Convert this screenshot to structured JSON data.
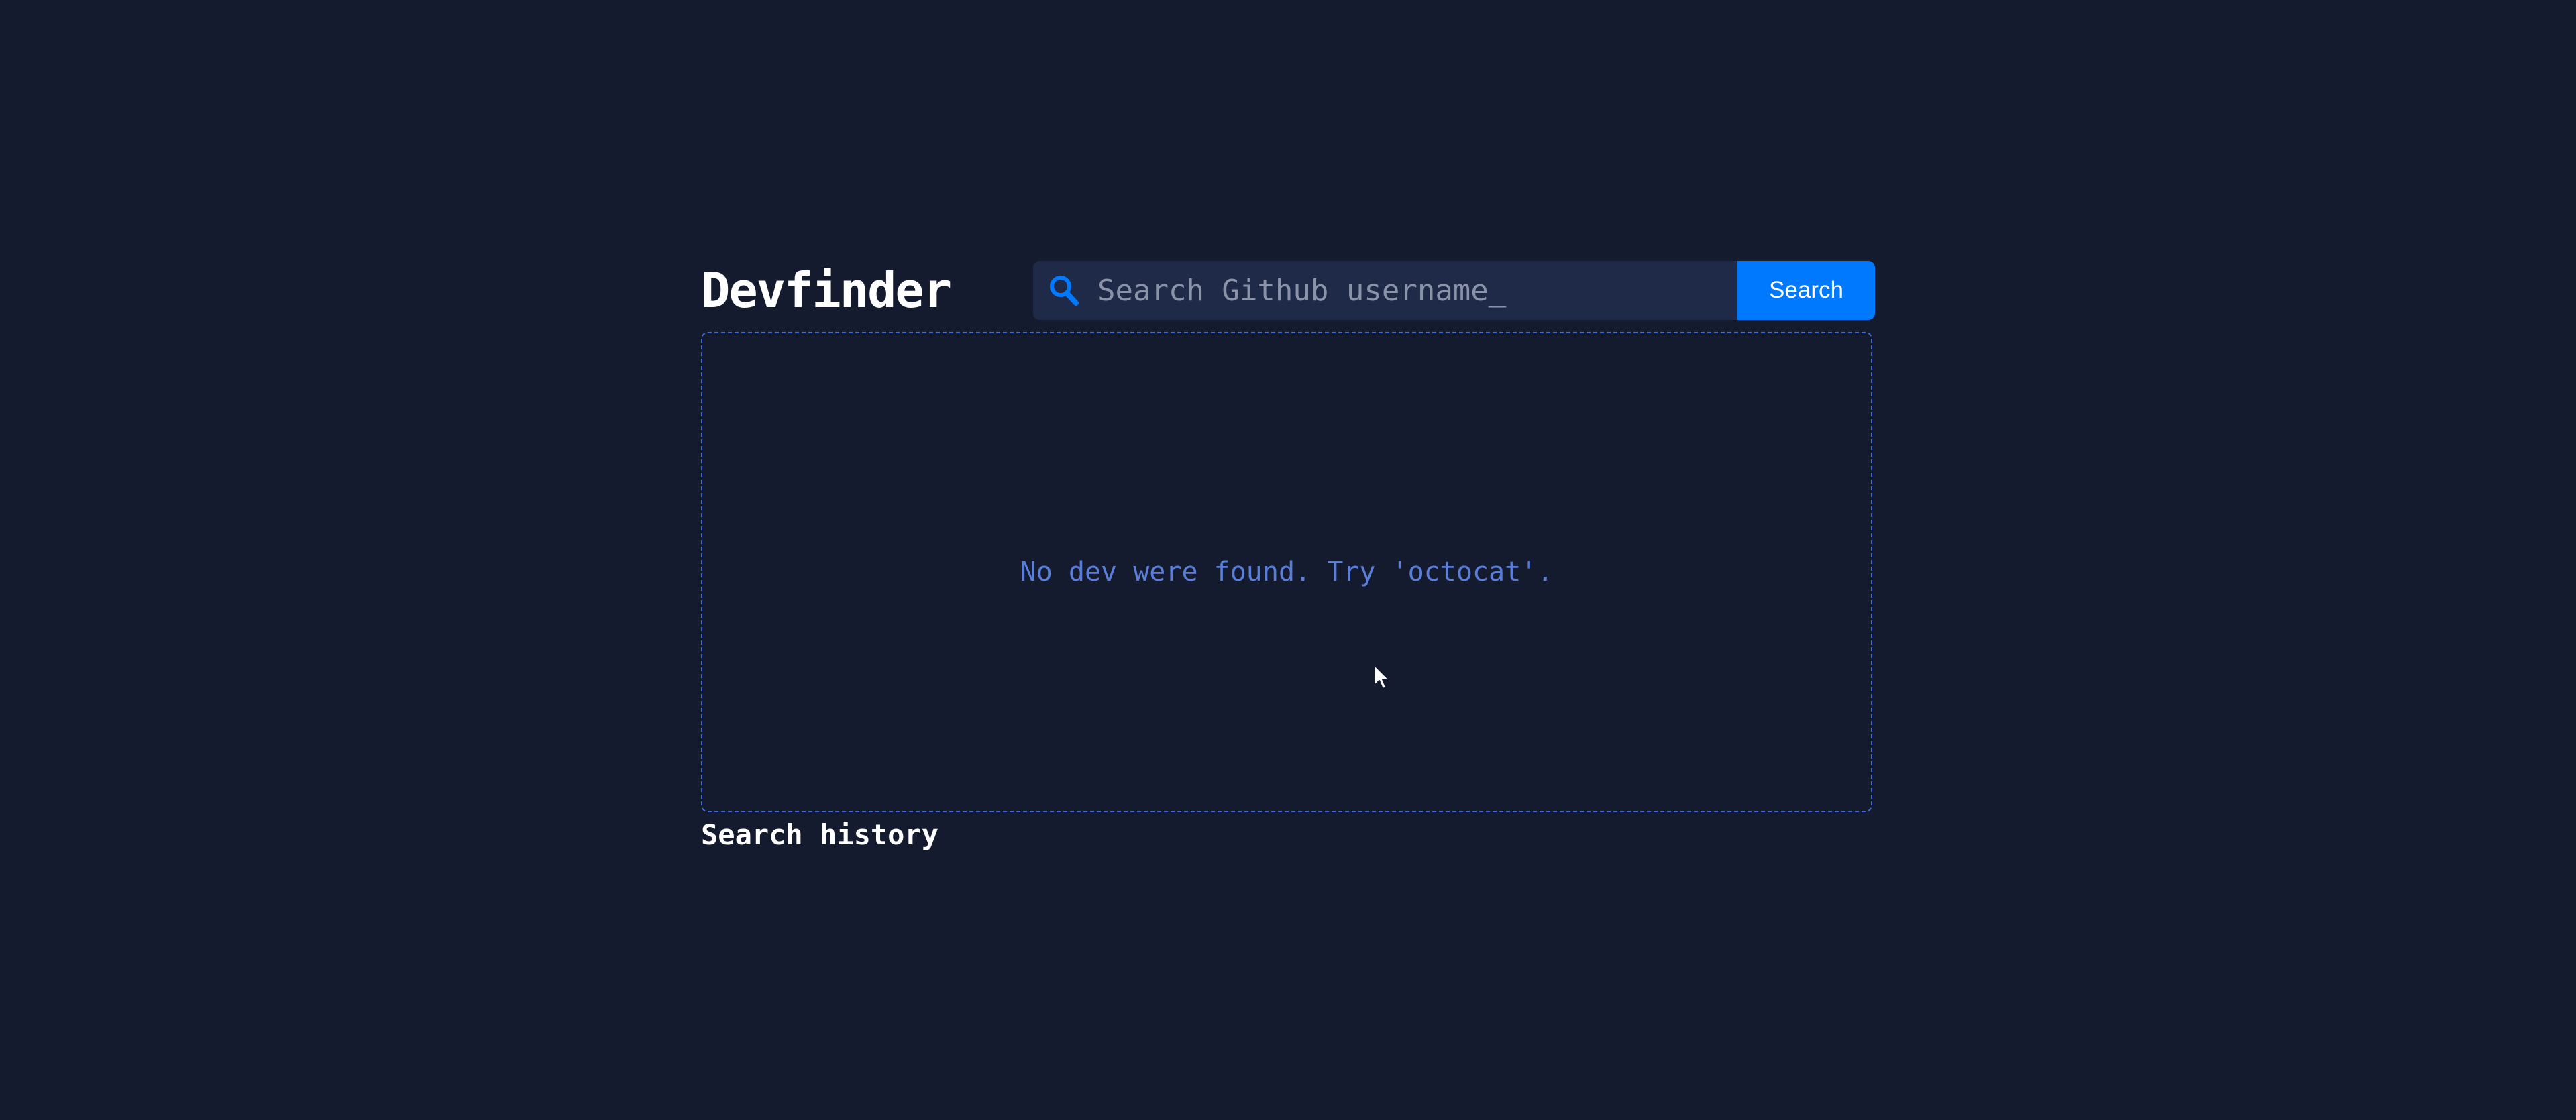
{
  "app": {
    "title": "Devfinder"
  },
  "search": {
    "placeholder": "Search Github username_",
    "value": "",
    "button_label": "Search",
    "icon": "search-icon"
  },
  "results": {
    "empty_message": "No dev were found. Try 'octocat'."
  },
  "history": {
    "title": "Search history",
    "items": []
  },
  "colors": {
    "background": "#151b2e",
    "input_background": "#1f2a48",
    "accent": "#0079ff",
    "empty_text": "#5b7fd8",
    "panel_border": "#3d6bd2"
  }
}
